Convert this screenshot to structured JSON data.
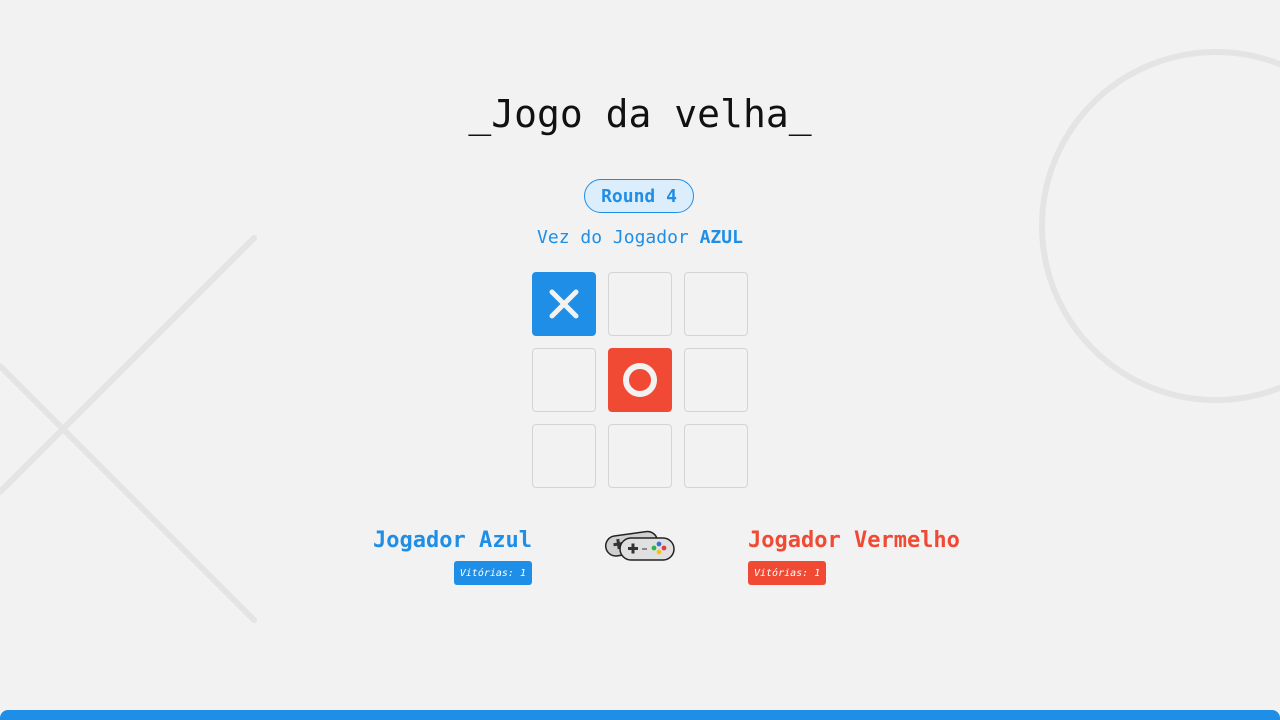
{
  "title": "_Jogo da velha_",
  "round": {
    "label": "Round 4"
  },
  "turn": {
    "prefix": "Vez do Jogador",
    "player": "AZUL"
  },
  "board": [
    {
      "mark": "X"
    },
    {
      "mark": ""
    },
    {
      "mark": ""
    },
    {
      "mark": ""
    },
    {
      "mark": "O"
    },
    {
      "mark": ""
    },
    {
      "mark": ""
    },
    {
      "mark": ""
    },
    {
      "mark": ""
    }
  ],
  "players": {
    "blue": {
      "name": "Jogador Azul",
      "wins": "Vitórias: 1"
    },
    "red": {
      "name": "Jogador Vermelho",
      "wins": "Vitórias: 1"
    }
  },
  "colors": {
    "blue": "#1f8ee6",
    "red": "#f04a35",
    "background": "#f2f2f2"
  },
  "icons": {
    "controllers": "game-controller-icon",
    "x": "x-mark-icon",
    "o": "o-mark-icon"
  }
}
